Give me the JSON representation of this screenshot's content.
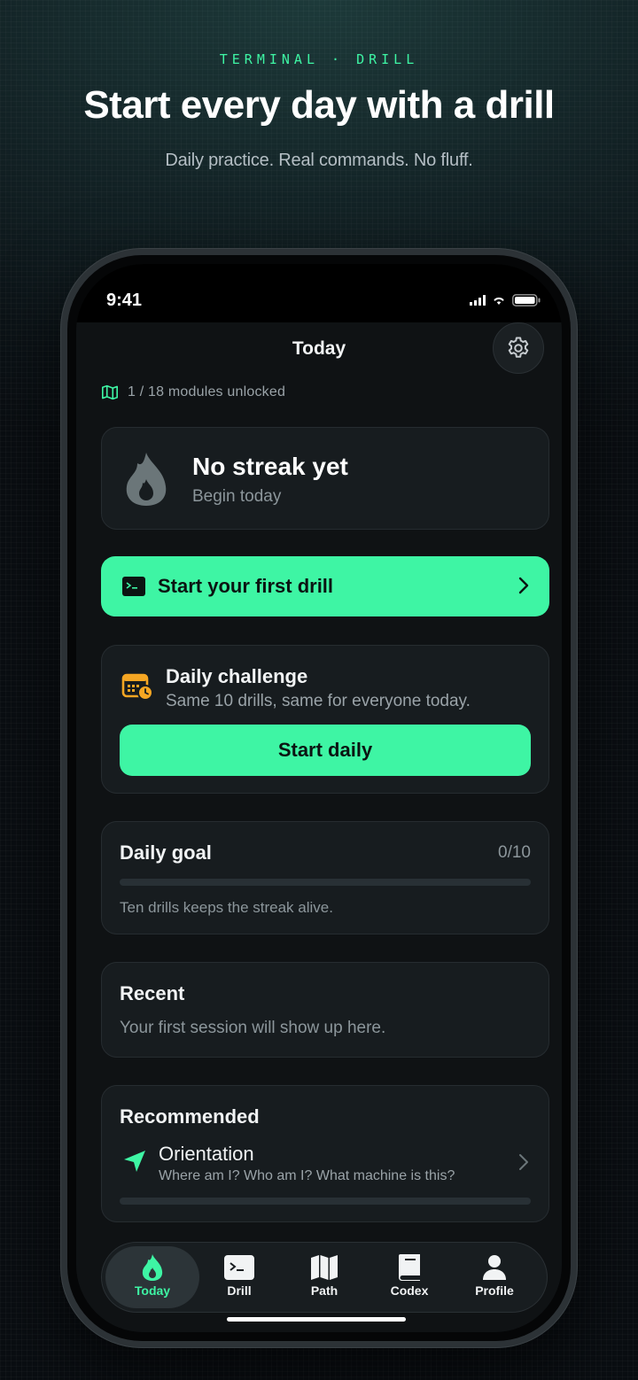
{
  "hero": {
    "eyebrow": "TERMINAL · DRILL",
    "headline": "Start every day with a drill",
    "subline": "Daily practice. Real commands. No fluff."
  },
  "status_bar": {
    "time": "9:41"
  },
  "header": {
    "title": "Today",
    "settings_icon": "gear-icon"
  },
  "modules": {
    "icon": "map-icon",
    "text": "1 / 18 modules unlocked"
  },
  "streak": {
    "icon": "flame-icon",
    "title": "No streak yet",
    "subtitle": "Begin today"
  },
  "start_first": {
    "icon": "terminal-icon",
    "label": "Start your first drill"
  },
  "daily_challenge": {
    "icon": "calendar-clock-icon",
    "title": "Daily challenge",
    "subtitle": "Same 10 drills, same for everyone today.",
    "button_label": "Start daily"
  },
  "daily_goal": {
    "title": "Daily goal",
    "count": "0/10",
    "progress": 0,
    "note": "Ten drills keeps the streak alive."
  },
  "recent": {
    "title": "Recent",
    "note": "Your first session will show up here."
  },
  "recommended": {
    "title": "Recommended",
    "item": {
      "icon": "navigation-arrow-icon",
      "name": "Orientation",
      "description": "Where am I? Who am I? What machine is this?",
      "progress": 0
    }
  },
  "tabs": [
    {
      "label": "Today",
      "icon": "flame-icon",
      "active": true
    },
    {
      "label": "Drill",
      "icon": "terminal-icon",
      "active": false
    },
    {
      "label": "Path",
      "icon": "map-icon",
      "active": false
    },
    {
      "label": "Codex",
      "icon": "book-icon",
      "active": false
    },
    {
      "label": "Profile",
      "icon": "person-icon",
      "active": false
    }
  ],
  "colors": {
    "accent": "#3ef5a4",
    "card": "#171c1f",
    "background": "#0f1214",
    "calendar_orange": "#f5a623"
  }
}
